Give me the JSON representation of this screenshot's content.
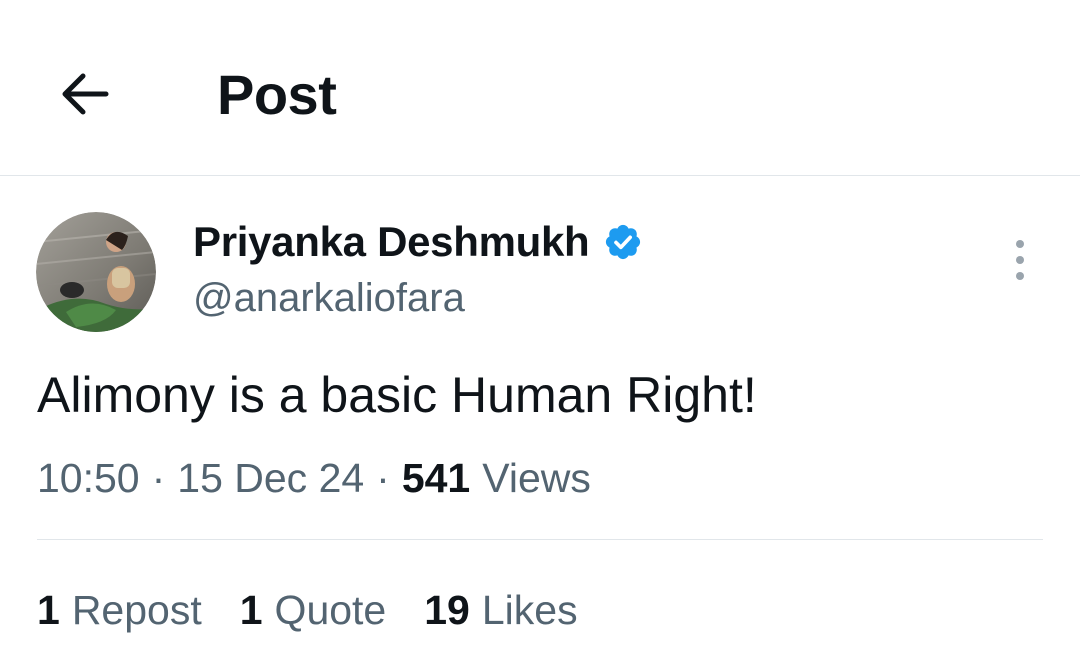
{
  "header": {
    "title": "Post",
    "back_icon": "arrow-left-icon"
  },
  "author": {
    "display_name": "Priyanka Deshmukh",
    "handle": "@anarkaliofara",
    "verified": true,
    "verified_color": "#1d9bf0",
    "avatar_icon": "avatar-photo"
  },
  "tweet": {
    "text": "Alimony is a basic Human Right!",
    "time": "10:50",
    "separator": "·",
    "date": "15 Dec 24",
    "views_count": "541",
    "views_label": "Views"
  },
  "stats": {
    "reposts_count": "1",
    "reposts_label": "Repost",
    "quotes_count": "1",
    "quotes_label": "Quote",
    "likes_count": "19",
    "likes_label": "Likes"
  },
  "colors": {
    "text_primary": "#0f1419",
    "text_secondary": "#536471",
    "divider": "#e1e6ea",
    "accent": "#1d9bf0"
  }
}
